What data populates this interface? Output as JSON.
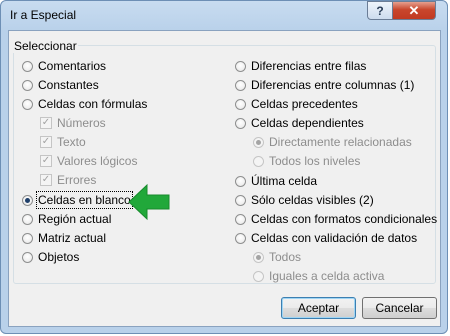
{
  "window": {
    "title": "Ir a Especial"
  },
  "titlebar": {
    "help_glyph": "?",
    "close_glyph": "✕"
  },
  "group": {
    "label": "Seleccionar"
  },
  "left": {
    "comentarios": "Comentarios",
    "constantes": "Constantes",
    "celdas_formulas": "Celdas con fórmulas",
    "numeros": "Números",
    "texto": "Texto",
    "valores_logicos": "Valores lógicos",
    "errores": "Errores",
    "celdas_blanco": "Celdas en blanco",
    "region_actual": "Región actual",
    "matriz_actual": "Matriz actual",
    "objetos": "Objetos"
  },
  "right": {
    "dif_filas": "Diferencias entre filas",
    "dif_columnas": "Diferencias entre columnas (1)",
    "precedentes": "Celdas precedentes",
    "dependientes": "Celdas dependientes",
    "directamente": "Directamente relacionadas",
    "todos_niveles": "Todos los niveles",
    "ultima_celda": "Última celda",
    "solo_visibles": "Sólo celdas visibles (2)",
    "formatos_cond": "Celdas con formatos condicionales",
    "validacion": "Celdas con validación de datos",
    "todos": "Todos",
    "iguales": "Iguales a celda activa"
  },
  "buttons": {
    "aceptar": "Aceptar",
    "cancelar": "Cancelar"
  },
  "state": {
    "selected_option": "Celdas en blanco"
  },
  "colors": {
    "arrow": "#21a83a",
    "title_bar": "#b9d1ea",
    "close_button": "#c9462c"
  },
  "icons": {
    "arrow": "green-arrow-left-icon"
  }
}
